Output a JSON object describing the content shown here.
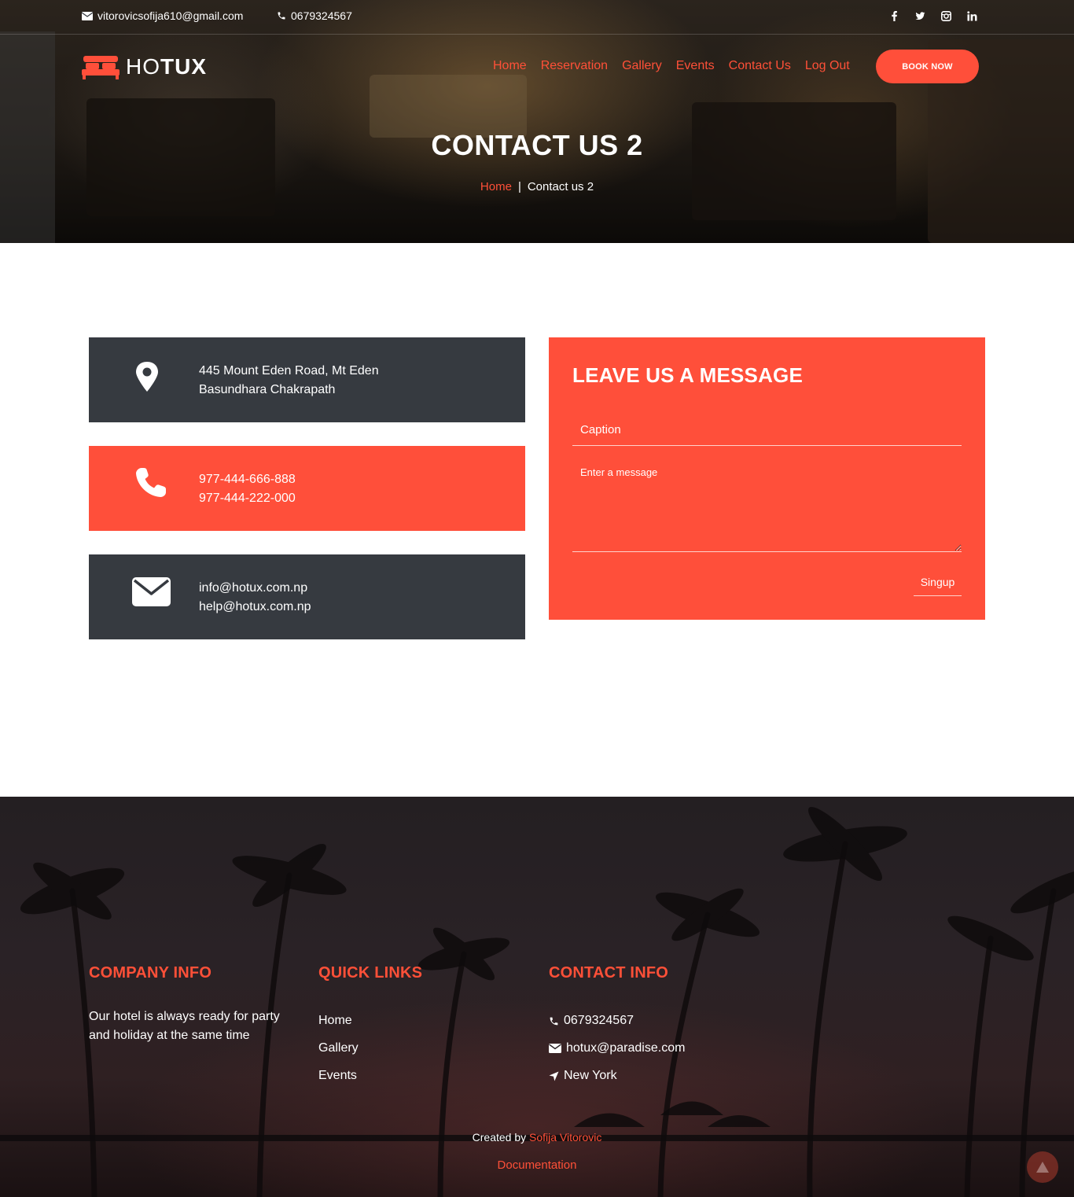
{
  "colors": {
    "accent": "#ff4f3a",
    "dark_card": "#363a40",
    "white": "#ffffff"
  },
  "topbar": {
    "email": "vitorovicsofija610@gmail.com",
    "phone": "0679324567",
    "social_icons": [
      "facebook-icon",
      "twitter-icon",
      "instagram-icon",
      "linkedin-icon"
    ]
  },
  "logo": {
    "part1": "HO",
    "part2": "TUX",
    "icon": "bed-icon"
  },
  "nav": {
    "items": [
      "Home",
      "Reservation",
      "Gallery",
      "Events",
      "Contact Us",
      "Log Out"
    ],
    "book_label": "BOOK NOW"
  },
  "hero": {
    "title": "CONTACT US 2",
    "breadcrumb_home": "Home",
    "breadcrumb_sep": "|",
    "breadcrumb_current": "Contact us 2"
  },
  "cards": [
    {
      "icon": "map-pin-icon",
      "line1": "445 Mount Eden Road, Mt Eden",
      "line2": "Basundhara Chakrapath"
    },
    {
      "icon": "phone-icon",
      "line1": "977-444-666-888",
      "line2": "977-444-222-000"
    },
    {
      "icon": "envelope-icon",
      "line1": "info@hotux.com.np",
      "line2": "help@hotux.com.np"
    }
  ],
  "form": {
    "title": "LEAVE US A MESSAGE",
    "caption_placeholder": "Caption",
    "message_placeholder": "Enter a message",
    "submit_label": "Singup"
  },
  "footer": {
    "company_heading": "COMPANY INFO",
    "company_text": "Our hotel is always ready for party and holiday at the same time",
    "links_heading": "QUICK LINKS",
    "links": [
      "Home",
      "Gallery",
      "Events"
    ],
    "contact_heading": "CONTACT INFO",
    "contact_phone": "0679324567",
    "contact_email": "hotux@paradise.com",
    "contact_location": "New York",
    "credit_prefix": "Created by",
    "credit_author": "Sofija Vitorovic",
    "documentation": "Documentation"
  }
}
